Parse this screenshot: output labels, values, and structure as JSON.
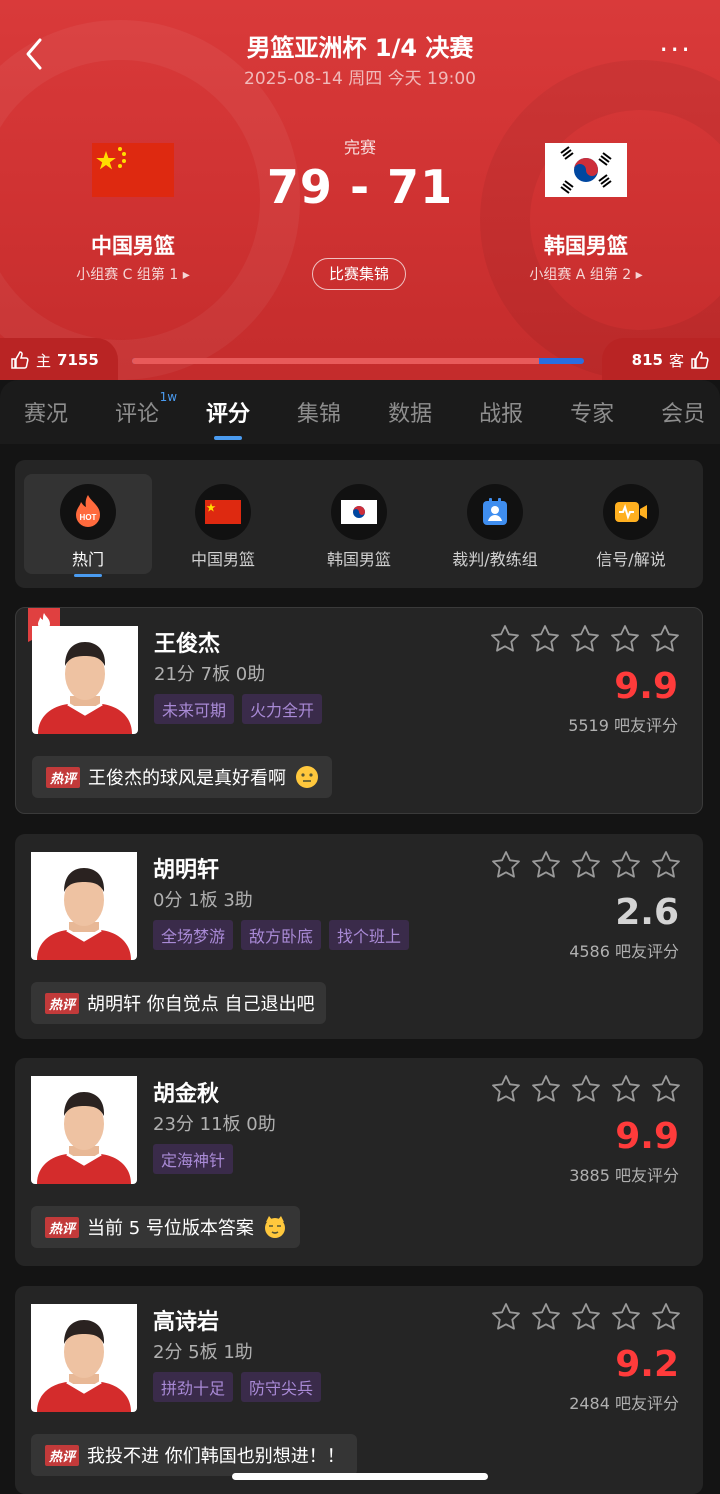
{
  "header": {
    "title": "男篮亚洲杯 1/4 决赛",
    "subtitle": "2025-08-14 周四 今天 19:00",
    "status": "完赛",
    "score": "79 - 71",
    "highlights_label": "比赛集锦",
    "home": {
      "name": "中国男篮",
      "rank": "小组赛 C 组第 1 ▸"
    },
    "away": {
      "name": "韩国男篮",
      "rank": "小组赛 A 组第 2 ▸"
    },
    "votes": {
      "home_label": "主",
      "home_count": "7155",
      "away_label": "客",
      "away_count": "815",
      "home_fraction": 0.9
    },
    "colors": {
      "brand_red": "#d93a3a",
      "accent_blue": "#4a9bf0"
    }
  },
  "tabs": [
    {
      "label": "赛况"
    },
    {
      "label": "评论",
      "badge": "1w"
    },
    {
      "label": "评分",
      "active": true
    },
    {
      "label": "集锦"
    },
    {
      "label": "数据"
    },
    {
      "label": "战报"
    },
    {
      "label": "专家"
    },
    {
      "label": "会员"
    }
  ],
  "filters": [
    {
      "label": "热门",
      "icon": "hot-icon",
      "active": true
    },
    {
      "label": "中国男篮",
      "icon": "china-flag-icon"
    },
    {
      "label": "韩国男篮",
      "icon": "korea-flag-icon"
    },
    {
      "label": "裁判/教练组",
      "icon": "referee-icon"
    },
    {
      "label": "信号/解说",
      "icon": "broadcast-icon"
    }
  ],
  "hot_badge": "热评",
  "players": [
    {
      "name": "王俊杰",
      "stats": "21分 7板 0助",
      "tags": [
        "未来可期",
        "火力全开"
      ],
      "rating": "9.9",
      "rating_count": "5519 吧友评分",
      "comment": "王俊杰的球风是真好看啊"
    },
    {
      "name": "胡明轩",
      "stats": "0分 1板 3助",
      "tags": [
        "全场梦游",
        "敌方卧底",
        "找个班上"
      ],
      "rating": "2.6",
      "rating_count": "4586 吧友评分",
      "comment": "胡明轩 你自觉点 自己退出吧"
    },
    {
      "name": "胡金秋",
      "stats": "23分 11板 0助",
      "tags": [
        "定海神针"
      ],
      "rating": "9.9",
      "rating_count": "3885 吧友评分",
      "comment": "当前 5 号位版本答案"
    },
    {
      "name": "高诗岩",
      "stats": "2分 5板 1助",
      "tags": [
        "拼劲十足",
        "防守尖兵"
      ],
      "rating": "9.2",
      "rating_count": "2484 吧友评分",
      "comment": "我投不进 你们韩国也别想进！！"
    }
  ]
}
